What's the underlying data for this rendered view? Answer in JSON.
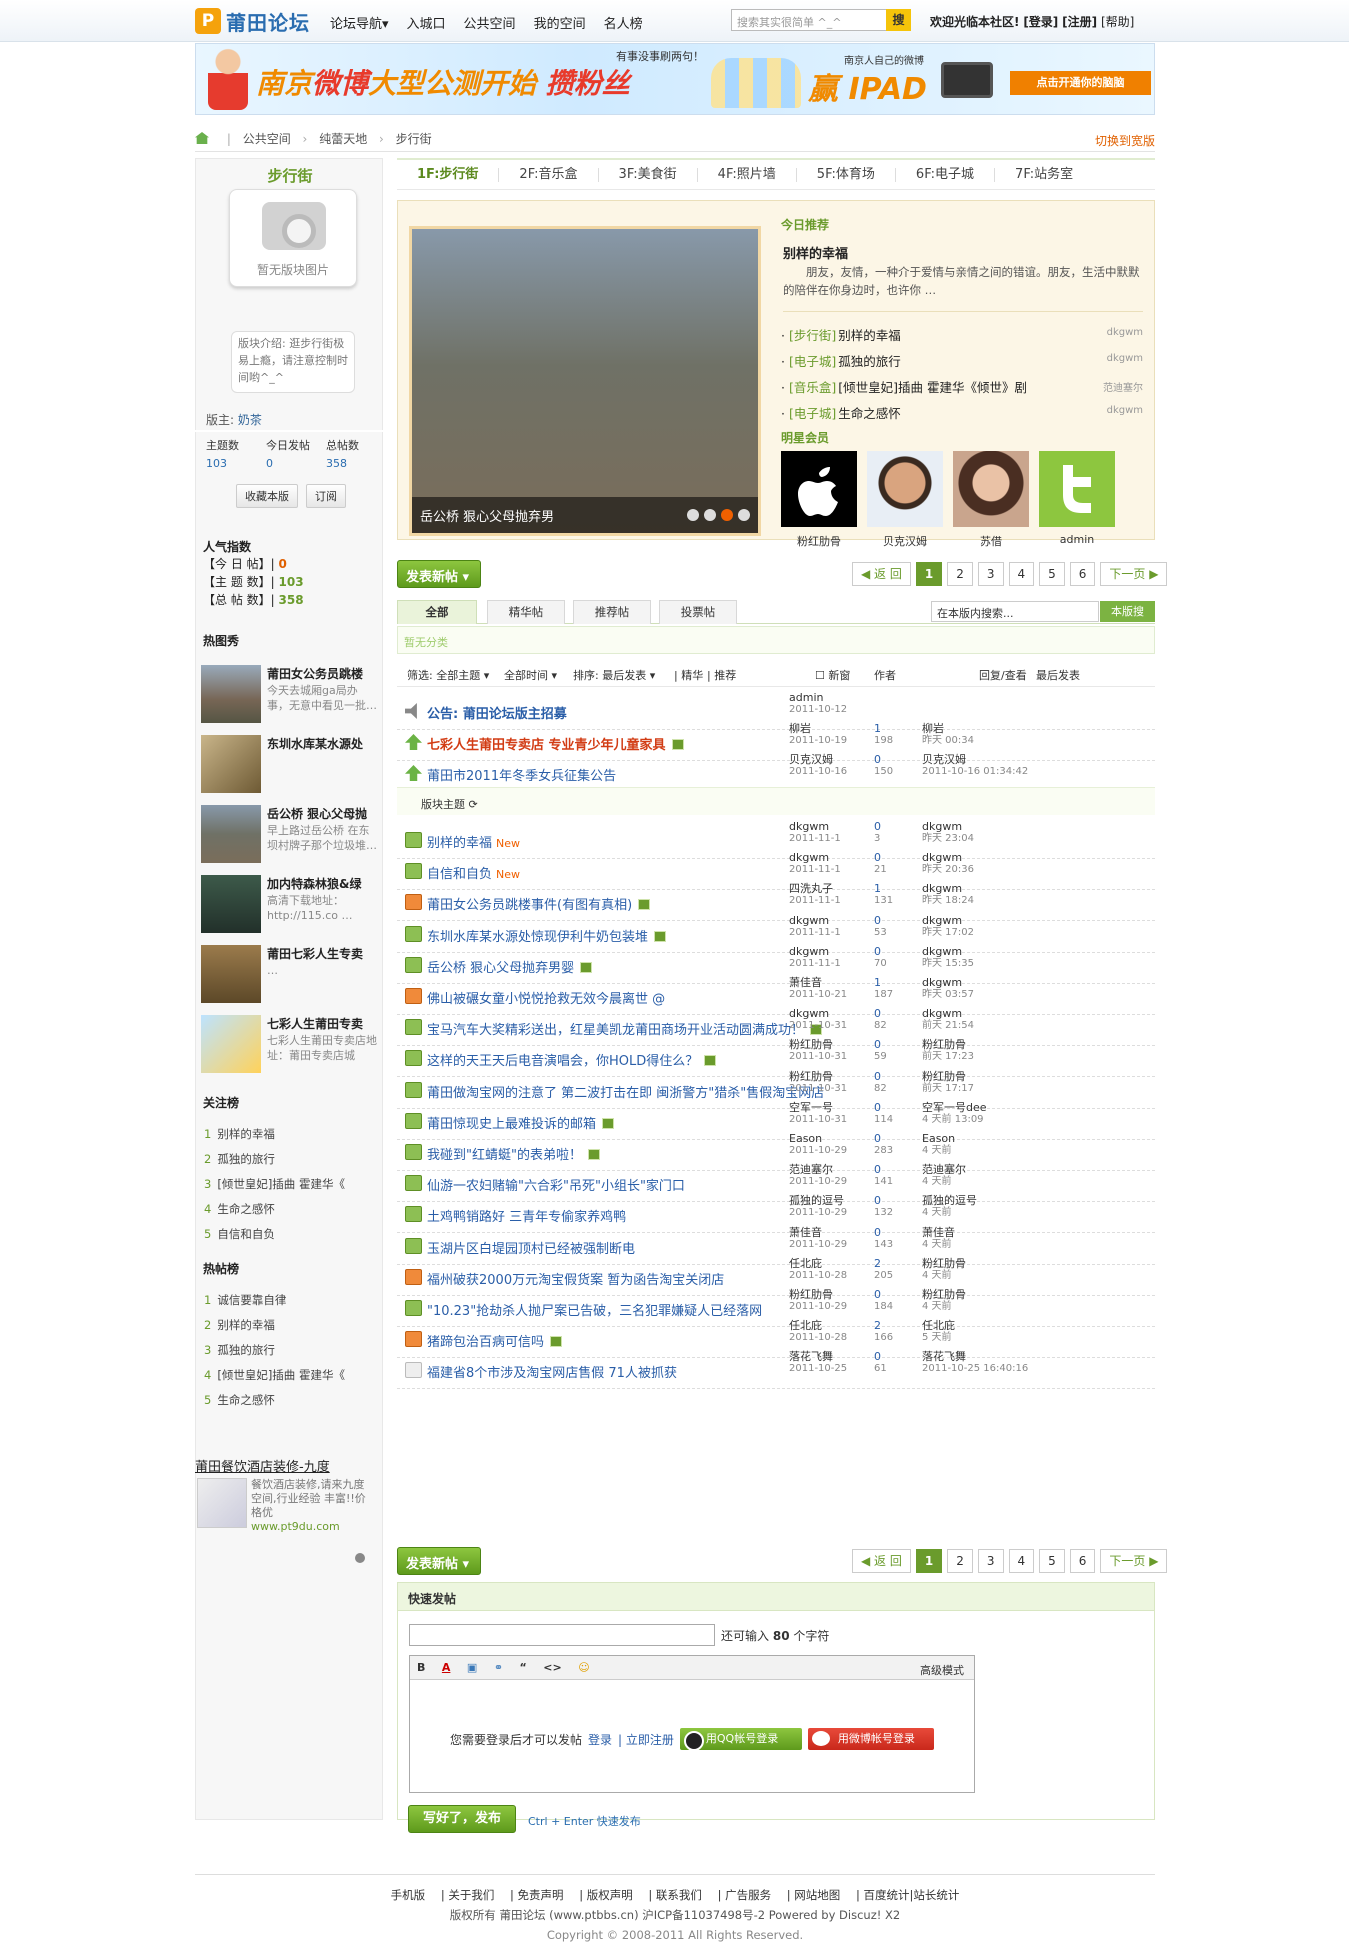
{
  "topbar": {
    "logo_text": "莆田论坛",
    "logo_mark": "P",
    "nav": [
      "论坛导航▾",
      "入城口",
      "公共空间",
      "我的空间",
      "名人榜"
    ],
    "search_placeholder": "搜索其实很简单 ^_^",
    "search_button": "搜",
    "welcome": "欢迎光临本社区!",
    "login": "[登录]",
    "register": "[注册]",
    "help": "[帮助]"
  },
  "banner": {
    "headline_a": "南京",
    "headline_b": "微博",
    "headline_c": "大型公测开始",
    "headline_d": "攒粉丝",
    "ipad_text": "赢 IPAD",
    "small_text": "有事没事刷两句！",
    "brand_text": "南京人自己的微博",
    "cta": "点击开通你的脑脑"
  },
  "breadcrumb": {
    "items": [
      "公共空间",
      "纯蕾天地",
      "步行街"
    ],
    "switch_wide": "切换到宽版"
  },
  "sidebar": {
    "forum_name": "步行街",
    "photo_caption": "暂无版块图片",
    "intro": "版块介绍: 逛步行街极易上瘾，请注意控制时间哟^_^",
    "moderator_label": "版主:",
    "moderator": "奶茶",
    "stats": [
      {
        "label": "主题数",
        "value": "103"
      },
      {
        "label": "今日发帖",
        "value": "0"
      },
      {
        "label": "总帖数",
        "value": "358"
      }
    ],
    "buttons": [
      "收藏本版",
      "订阅"
    ],
    "popularity_title": "人气指数",
    "popularity": [
      {
        "label": "【今 日 帖】|",
        "value": "0"
      },
      {
        "label": "【主 题 数】|",
        "value": "103"
      },
      {
        "label": "【总 帖 数】|",
        "value": "358"
      }
    ],
    "hot_pics_title": "热图秀",
    "hot_pics": [
      {
        "title": "莆田女公务员跳楼",
        "desc": "今天去城厢ga局办事，无意中看见一批…"
      },
      {
        "title": "东圳水库某水源处",
        "desc": ""
      },
      {
        "title": "岳公桥 狠心父母抛",
        "desc": "早上路过岳公桥 在东坝村牌子那个垃圾堆…"
      },
      {
        "title": "加内特森林狼&绿",
        "desc": "高清下载地址：http://115.co …"
      },
      {
        "title": "莆田七彩人生专卖",
        "desc": "…"
      },
      {
        "title": "七彩人生莆田专卖",
        "desc": "七彩人生莆田专卖店地址：莆田专卖店城"
      }
    ],
    "focus_title": "关注榜",
    "focus": [
      "别样的幸福",
      "孤独的旅行",
      "[倾世皇妃]插曲 霍建华《",
      "生命之感怀",
      "自信和自负"
    ],
    "hot_title": "热帖榜",
    "hot": [
      "诚信要靠自律",
      "别样的幸福",
      "孤独的旅行",
      "[倾世皇妃]插曲 霍建华《",
      "生命之感怀"
    ],
    "ad_title": "莆田餐饮酒店装修-九度",
    "ad_desc": "餐饮酒店装修,请来九度空间,行业经验 丰富!!价格优",
    "ad_url": "www.pt9du.com"
  },
  "floors": [
    "1F:步行街",
    "2F:音乐盒",
    "3F:美食街",
    "4F:照片墙",
    "5F:体育场",
    "6F:电子城",
    "7F:站务室"
  ],
  "feature": {
    "slide_caption": "岳公桥 狠心父母抛弃男",
    "recommend_title": "今日推荐",
    "rec_post_title": "别样的幸福",
    "rec_post_desc": "朋友，友情，一种介于爱情与亲情之间的错谊。朋友，生活中默默的陪伴在你身边时，也许你 …",
    "rec_list": [
      {
        "cat": "[步行街]",
        "title": "别样的幸福",
        "author": "dkgwm"
      },
      {
        "cat": "[电子城]",
        "title": "孤独的旅行",
        "author": "dkgwm"
      },
      {
        "cat": "[音乐盒]",
        "title": "[倾世皇妃]插曲 霍建华《倾世》剧",
        "author": "范迪塞尔"
      },
      {
        "cat": "[电子城]",
        "title": "生命之感怀",
        "author": "dkgwm"
      }
    ],
    "stars_title": "明星会员",
    "stars": [
      "粉红肋骨",
      "贝克汉姆",
      "苏借",
      "admin"
    ]
  },
  "actions": {
    "new_post": "发表新帖 ▾",
    "back": "◀ 返 回",
    "pages": [
      "1",
      "2",
      "3",
      "4",
      "5",
      "6"
    ],
    "next": "下一页 ▶"
  },
  "tabs": [
    "全部",
    "精华帖",
    "推荐帖",
    "投票帖"
  ],
  "forum_search": {
    "placeholder": "在本版内搜索...",
    "button": "本版搜"
  },
  "no_category": "暂无分类",
  "filter": {
    "label": "筛选:",
    "all_topics": "全部主题 ▾",
    "all_time": "全部时间 ▾",
    "sort": "排序: 最后发表 ▾",
    "digest": "| 精华",
    "recommend": "| 推荐",
    "new": "☐ 新窗",
    "col_author": "作者",
    "col_reply": "回复/查看",
    "col_last": "最后发表"
  },
  "threads_top": [
    {
      "icon": "ann",
      "title": "公告: 莆田论坛版主招募",
      "cls": "b",
      "author": "admin",
      "date": "2011-10-12",
      "reply": "",
      "view": "",
      "last": "",
      "last_time": ""
    },
    {
      "icon": "top",
      "title": "七彩人生莆田专卖店 专业青少年儿童家具",
      "cls": "red b",
      "att": true,
      "author": "柳岩",
      "date": "2011-10-19",
      "reply": "1",
      "view": "198",
      "last": "柳岩",
      "last_time": "昨天 00:34"
    },
    {
      "icon": "top",
      "title": "莆田市2011年冬季女兵征集公告",
      "cls": "",
      "author": "贝克汉姆",
      "date": "2011-10-16",
      "reply": "0",
      "view": "150",
      "last": "贝克汉姆",
      "last_time": "2011-10-16 01:34:42"
    }
  ],
  "section_label": "版块主题 ⟳",
  "threads": [
    {
      "icon": "f",
      "title": "别样的幸福",
      "new": "New",
      "author": "dkgwm",
      "date": "2011-11-1",
      "reply": "0",
      "view": "3",
      "last": "dkgwm",
      "last_time": "昨天 23:04"
    },
    {
      "icon": "f",
      "title": "自信和自负",
      "new": "New",
      "author": "dkgwm",
      "date": "2011-11-1",
      "reply": "0",
      "view": "21",
      "last": "dkgwm",
      "last_time": "昨天 20:36"
    },
    {
      "icon": "h",
      "title": "莆田女公务员跳楼事件(有图有真相)",
      "att": true,
      "author": "四洗丸子",
      "date": "2011-11-1",
      "reply": "1",
      "view": "131",
      "last": "dkgwm",
      "last_time": "昨天 18:24"
    },
    {
      "icon": "f",
      "title": "东圳水库某水源处惊现伊利牛奶包装堆",
      "att": true,
      "author": "dkgwm",
      "date": "2011-11-1",
      "reply": "0",
      "view": "53",
      "last": "dkgwm",
      "last_time": "昨天 17:02"
    },
    {
      "icon": "f",
      "title": "岳公桥 狠心父母抛弃男婴",
      "att": true,
      "author": "dkgwm",
      "date": "2011-11-1",
      "reply": "0",
      "view": "70",
      "last": "dkgwm",
      "last_time": "昨天 15:35"
    },
    {
      "icon": "h",
      "title": "佛山被碾女童小悦悦抢救无效今晨离世 @",
      "author": "萧佳音",
      "date": "2011-10-21",
      "reply": "1",
      "view": "187",
      "last": "dkgwm",
      "last_time": "昨天 03:57"
    },
    {
      "icon": "f",
      "title": "宝马汽车大奖精彩送出，红星美凯龙莆田商场开业活动圆满成功！",
      "att": true,
      "author": "dkgwm",
      "date": "2011-10-31",
      "reply": "0",
      "view": "82",
      "last": "dkgwm",
      "last_time": "前天 21:54"
    },
    {
      "icon": "f",
      "title": "这样的天王天后电音演唱会，你HOLD得住么？",
      "att": true,
      "author": "粉红肋骨",
      "date": "2011-10-31",
      "reply": "0",
      "view": "59",
      "last": "粉红肋骨",
      "last_time": "前天 17:23"
    },
    {
      "icon": "f",
      "title": "莆田做淘宝网的注意了 第二波打击在即 闽浙警方\"猎杀\"售假淘宝网店",
      "author": "粉红肋骨",
      "date": "2011-10-31",
      "reply": "0",
      "view": "82",
      "last": "粉红肋骨",
      "last_time": "前天 17:17"
    },
    {
      "icon": "f",
      "title": "莆田惊现史上最难投诉的邮箱",
      "att": true,
      "author": "空军一号",
      "date": "2011-10-31",
      "reply": "0",
      "view": "114",
      "last": "空军一号dee",
      "last_time": "4 天前 13:09"
    },
    {
      "icon": "f",
      "title": "我碰到\"红蜻蜓\"的表弟啦！",
      "att": true,
      "author": "Eason",
      "date": "2011-10-29",
      "reply": "0",
      "view": "283",
      "last": "Eason",
      "last_time": "4 天前"
    },
    {
      "icon": "f",
      "title": "仙游一农妇赌输\"六合彩\"吊死\"小组长\"家门口",
      "author": "范迪塞尔",
      "date": "2011-10-29",
      "reply": "0",
      "view": "141",
      "last": "范迪塞尔",
      "last_time": "4 天前"
    },
    {
      "icon": "f",
      "title": "土鸡鸭销路好 三青年专偷家养鸡鸭",
      "author": "孤独的逗号",
      "date": "2011-10-29",
      "reply": "0",
      "view": "132",
      "last": "孤独的逗号",
      "last_time": "4 天前"
    },
    {
      "icon": "f",
      "title": "玉湖片区白堤园顶村已经被强制断电",
      "author": "萧佳音",
      "date": "2011-10-29",
      "reply": "0",
      "view": "143",
      "last": "萧佳音",
      "last_time": "4 天前"
    },
    {
      "icon": "h",
      "title": "福州破获2000万元淘宝假货案 暂为函告淘宝关闭店",
      "author": "任北庇",
      "date": "2011-10-28",
      "reply": "2",
      "view": "205",
      "last": "粉红肋骨",
      "last_time": "4 天前"
    },
    {
      "icon": "f",
      "title": "\"10.23\"抢劫杀人抛尸案已告破，三名犯罪嫌疑人已经落网",
      "author": "粉红肋骨",
      "date": "2011-10-29",
      "reply": "0",
      "view": "184",
      "last": "粉红肋骨",
      "last_time": "4 天前"
    },
    {
      "icon": "h",
      "title": "猪蹄包治百病可信吗",
      "att": true,
      "author": "任北庇",
      "date": "2011-10-28",
      "reply": "2",
      "view": "166",
      "last": "任北庇",
      "last_time": "5 天前"
    },
    {
      "icon": "n",
      "title": "福建省8个市涉及淘宝网店售假 71人被抓获",
      "author": "落花飞舞",
      "date": "2011-10-25",
      "reply": "0",
      "view": "61",
      "last": "落花飞舞",
      "last_time": "2011-10-25 16:40:16"
    }
  ],
  "quick_post": {
    "title": "快速发帖",
    "remaining_a": "还可输入",
    "remaining_n": "80",
    "remaining_b": "个字符",
    "toolbar": [
      "B",
      "A",
      "▣",
      "⚭",
      "“",
      "<>",
      "☺"
    ],
    "advanced": "高级模式",
    "login_hint": "您需要登录后才可以发帖",
    "login": "登录",
    "register": "| 立即注册",
    "qq_login": "用QQ帐号登录",
    "weibo_login": "用微博帐号登录",
    "submit": "写好了，发布",
    "shortcut": "Ctrl + Enter 快速发布"
  },
  "footer": {
    "links": [
      "手机版",
      "| 关于我们",
      "| 免责声明",
      "| 版权声明",
      "| 联系我们",
      "| 广告服务",
      "| 网站地图",
      "| 百度统计|站长统计"
    ],
    "line2": "版权所有 莆田论坛 (www.ptbbs.cn) 沪ICP备11037498号-2 Powered by Discuz! X2",
    "line3": "Copyright © 2008-2011 All Rights Reserved."
  }
}
